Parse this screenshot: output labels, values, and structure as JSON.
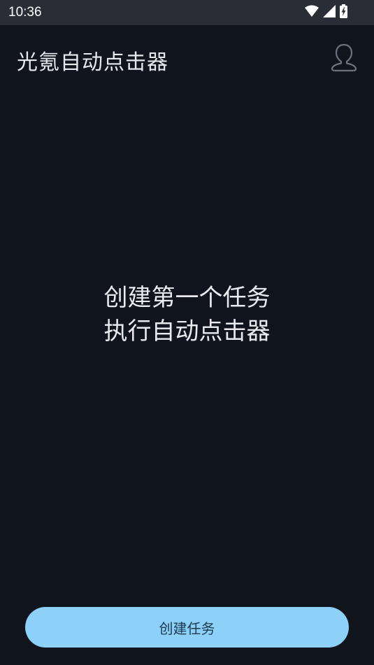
{
  "status_bar": {
    "time": "10:36",
    "icons": [
      "wifi-icon",
      "signal-icon",
      "battery-charging-icon"
    ]
  },
  "app_bar": {
    "title": "光氪自动点击器",
    "profile_icon": "user-profile-icon"
  },
  "empty_state": {
    "line1": "创建第一个任务",
    "line2": "执行自动点击器"
  },
  "actions": {
    "create_label": "创建任务"
  },
  "colors": {
    "background": "#10141c",
    "status_bar": "#2a2d35",
    "primary_button": "#8dd0f8",
    "primary_button_text": "#1c3a52"
  }
}
